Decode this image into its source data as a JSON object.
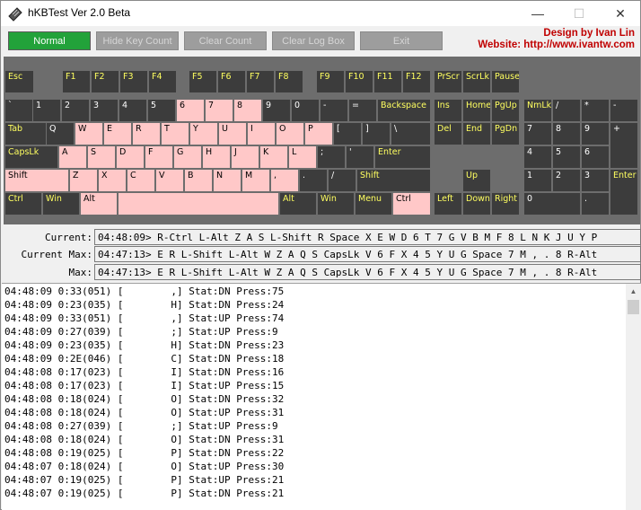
{
  "window": {
    "title": "hKBTest Ver 2.0 Beta",
    "minimize": "—",
    "maximize": "☐",
    "close": "✕"
  },
  "toolbar": {
    "normal": "Normal",
    "hide_key_count": "Hide Key Count",
    "clear_count": "Clear Count",
    "clear_log_box": "Clear Log Box",
    "exit": "Exit"
  },
  "credit": {
    "line1": "Design by Ivan Lin",
    "line2": "Website: http://www.ivantw.com"
  },
  "colors": {
    "pressed_key": "#ffc8c8",
    "key": "#3c3c3c",
    "key_text": "#ffff60",
    "normal_button": "#22a23a",
    "credit": "#c00000"
  },
  "keys": {
    "esc": "Esc",
    "f1": "F1",
    "f2": "F2",
    "f3": "F3",
    "f4": "F4",
    "f5": "F5",
    "f6": "F6",
    "f7": "F7",
    "f8": "F8",
    "f9": "F9",
    "f10": "F10",
    "f11": "F11",
    "f12": "F12",
    "prscr": "PrScr",
    "scrlk": "ScrLk",
    "pause": "Pause",
    "grave": "`",
    "d1": "1",
    "d2": "2",
    "d3": "3",
    "d4": "4",
    "d5": "5",
    "d6": "6",
    "d7": "7",
    "d8": "8",
    "d9": "9",
    "d0": "0",
    "minus": "-",
    "equal": "=",
    "backspace": "Backspace",
    "ins": "Ins",
    "home": "Home",
    "pgup": "PgUp",
    "numlk": "NmLk",
    "np_div": "/",
    "np_mul": "*",
    "np_sub": "-",
    "tab": "Tab",
    "q": "Q",
    "w": "W",
    "e": "E",
    "r": "R",
    "t": "T",
    "y": "Y",
    "u": "U",
    "i": "I",
    "o": "O",
    "p": "P",
    "lbr": "[",
    "rbr": "]",
    "bslash": "\\",
    "del": "Del",
    "end": "End",
    "pgdn": "PgDn",
    "np7": "7",
    "np8": "8",
    "np9": "9",
    "np_add": "+",
    "capslk": "CapsLk",
    "a": "A",
    "s": "S",
    "d": "D",
    "f": "F",
    "g": "G",
    "h": "H",
    "j": "J",
    "k": "K",
    "l": "L",
    "semi": ";",
    "quote": "'",
    "enter": "Enter",
    "np4": "4",
    "np5": "5",
    "np6": "6",
    "lshift": "Shift",
    "z": "Z",
    "x": "X",
    "c": "C",
    "v": "V",
    "b": "B",
    "n": "N",
    "m": "M",
    "comma": ",",
    "period": ".",
    "slash": "/",
    "rshift": "Shift",
    "up": "Up",
    "np1": "1",
    "np2": "2",
    "np3": "3",
    "np_enter": "Enter",
    "lctrl": "Ctrl",
    "lwin": "Win",
    "lalt": "Alt",
    "space": "",
    "ralt": "Alt",
    "rwin": "Win",
    "menu": "Menu",
    "rctrl": "Ctrl",
    "left": "Left",
    "down": "Down",
    "right": "Right",
    "np0": "0",
    "np_dot": "."
  },
  "status": {
    "current_label": "Current:",
    "current_value": "04:48:09> R-Ctrl L-Alt Z A S L-Shift R Space X E W D 6 T 7 G V B M F 8 L N K J U Y P",
    "current_max_label": "Current Max:",
    "current_max_value": "04:47:13> E R L-Shift L-Alt W Z A Q S CapsLk V 6 F X 4 5 Y U G Space 7 M , . 8 R-Alt",
    "max_label": "Max:",
    "max_value": "04:47:13> E R L-Shift L-Alt W Z A Q S CapsLk V 6 F X 4 5 Y U G Space 7 M , . 8 R-Alt"
  },
  "log": [
    "04:48:09 0:33(051) [        ,] Stat:DN Press:75",
    "04:48:09 0:23(035) [        H] Stat:DN Press:24",
    "04:48:09 0:33(051) [        ,] Stat:UP Press:74",
    "04:48:09 0:27(039) [        ;] Stat:UP Press:9",
    "04:48:09 0:23(035) [        H] Stat:DN Press:23",
    "04:48:09 0:2E(046) [        C] Stat:DN Press:18",
    "04:48:08 0:17(023) [        I] Stat:DN Press:16",
    "04:48:08 0:17(023) [        I] Stat:UP Press:15",
    "04:48:08 0:18(024) [        O] Stat:DN Press:32",
    "04:48:08 0:18(024) [        O] Stat:UP Press:31",
    "04:48:08 0:27(039) [        ;] Stat:UP Press:9",
    "04:48:08 0:18(024) [        O] Stat:DN Press:31",
    "04:48:08 0:19(025) [        P] Stat:DN Press:22",
    "04:48:07 0:18(024) [        O] Stat:UP Press:30",
    "04:48:07 0:19(025) [        P] Stat:UP Press:21",
    "04:48:07 0:19(025) [        P] Stat:DN Press:21"
  ]
}
